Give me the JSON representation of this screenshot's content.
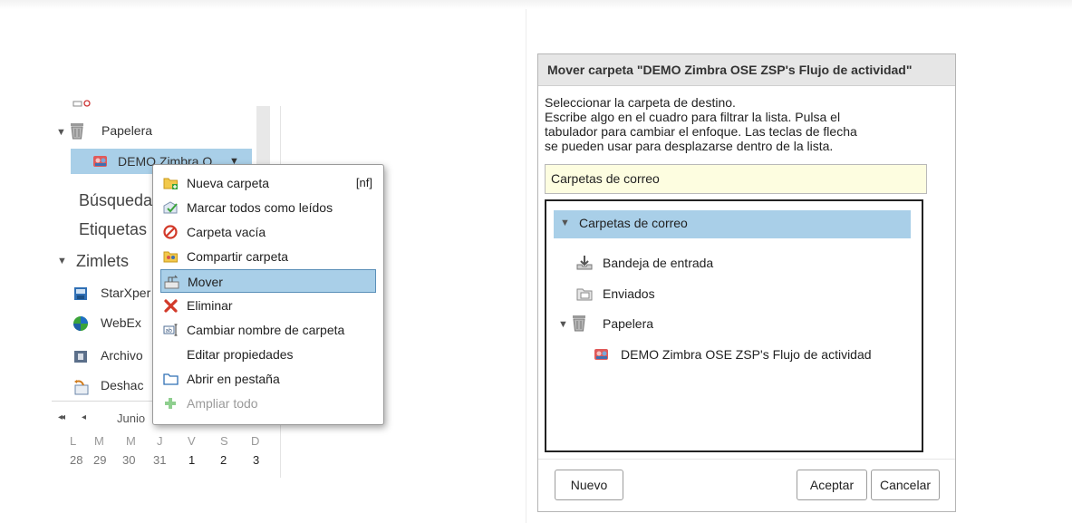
{
  "left": {
    "tree": {
      "papelera_label": "Papelera",
      "selected_folder_label": "DEMO Zimbra O",
      "busquedas_label": "Búsqueda",
      "etiquetas_label": "Etiquetas",
      "zimlets_label": "Zimlets",
      "zimlet_items": [
        {
          "label": "StarXper",
          "icon": "starxpert-icon"
        },
        {
          "label": "WebEx",
          "icon": "webex-icon"
        },
        {
          "label": "Archivo",
          "icon": "archive-icon"
        },
        {
          "label": "Deshac",
          "icon": "undo-icon"
        }
      ]
    },
    "calendar": {
      "month_label": "Junio",
      "prev_year": "◂◂",
      "prev_month": "◂",
      "weekdays": [
        "L",
        "M",
        "M",
        "J",
        "V",
        "S",
        "D"
      ],
      "dates": [
        "28",
        "29",
        "30",
        "31",
        "1",
        "2",
        "3"
      ]
    }
  },
  "context_menu": {
    "items": [
      {
        "label": "Nueva carpeta",
        "shortcut": "[nf]",
        "icon": "new-folder-icon"
      },
      {
        "label": "Marcar todos como leídos",
        "icon": "mark-read-icon"
      },
      {
        "label": "Carpeta vacía",
        "icon": "empty-folder-icon"
      },
      {
        "label": "Compartir carpeta",
        "icon": "share-folder-icon"
      },
      {
        "label": "Mover",
        "icon": "move-icon",
        "selected": true
      },
      {
        "label": "Eliminar",
        "icon": "delete-icon"
      },
      {
        "label": "Cambiar nombre de carpeta",
        "icon": "rename-icon"
      },
      {
        "label": "Editar propiedades",
        "icon": ""
      },
      {
        "label": "Abrir en pestaña",
        "icon": "open-tab-icon"
      },
      {
        "label": "Ampliar todo",
        "icon": "expand-all-icon",
        "disabled": true
      }
    ]
  },
  "dialog": {
    "title": "Mover carpeta \"DEMO Zimbra OSE ZSP's Flujo de actividad\"",
    "instructions": [
      "Seleccionar la carpeta de destino.",
      "Escribe algo en el cuadro para filtrar la lista. Pulsa el",
      "tabulador para cambiar el enfoque. Las teclas de flecha",
      "se pueden usar para desplazarse dentro de la lista."
    ],
    "filter_value": "Carpetas de correo",
    "tree": {
      "root_label": "Carpetas de correo",
      "items": [
        {
          "label": "Bandeja de entrada",
          "icon": "inbox-icon"
        },
        {
          "label": "Enviados",
          "icon": "sent-icon"
        },
        {
          "label": "Papelera",
          "icon": "trash-icon"
        },
        {
          "label": "DEMO Zimbra OSE ZSP's Flujo de actividad",
          "icon": "shared-folder-icon"
        }
      ]
    },
    "buttons": {
      "new": "Nuevo",
      "ok": "Aceptar",
      "cancel": "Cancelar"
    }
  },
  "colors": {
    "selection": "#a9cfe8",
    "filter_bg": "#fdfde0"
  }
}
